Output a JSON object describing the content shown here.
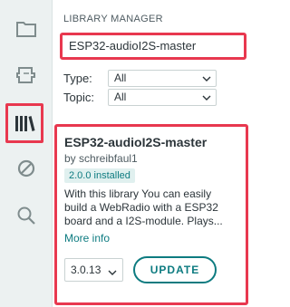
{
  "sidebar": {
    "items": [
      {
        "icon": "folder-icon",
        "active": false
      },
      {
        "icon": "board-manager-icon",
        "active": false
      },
      {
        "icon": "library-icon",
        "active": true
      },
      {
        "icon": "debug-icon",
        "active": false
      },
      {
        "icon": "search-icon",
        "active": false
      }
    ]
  },
  "panel": {
    "title": "LIBRARY MANAGER",
    "search": {
      "value": "ESP32-audioI2S-master"
    },
    "filters": {
      "type": {
        "label": "Type:",
        "value": "All"
      },
      "topic": {
        "label": "Topic:",
        "value": "All"
      }
    }
  },
  "card": {
    "name": "ESP32-audioI2S-master",
    "author": "by schreibfaul1",
    "installed_badge": "2.0.0 installed",
    "description_line1": "With this library You can easily",
    "description_line2": "build a WebRadio with a ESP32",
    "description_line3": "board and a I2S-module. Plays...",
    "more_info": "More info",
    "version": "3.0.13",
    "update_label": "UPDATE"
  },
  "colors": {
    "highlight": "#e8384f",
    "accent": "#0d7b80",
    "sidebar_bg": "#ecf1f1",
    "icon": "#7f8c8d"
  }
}
